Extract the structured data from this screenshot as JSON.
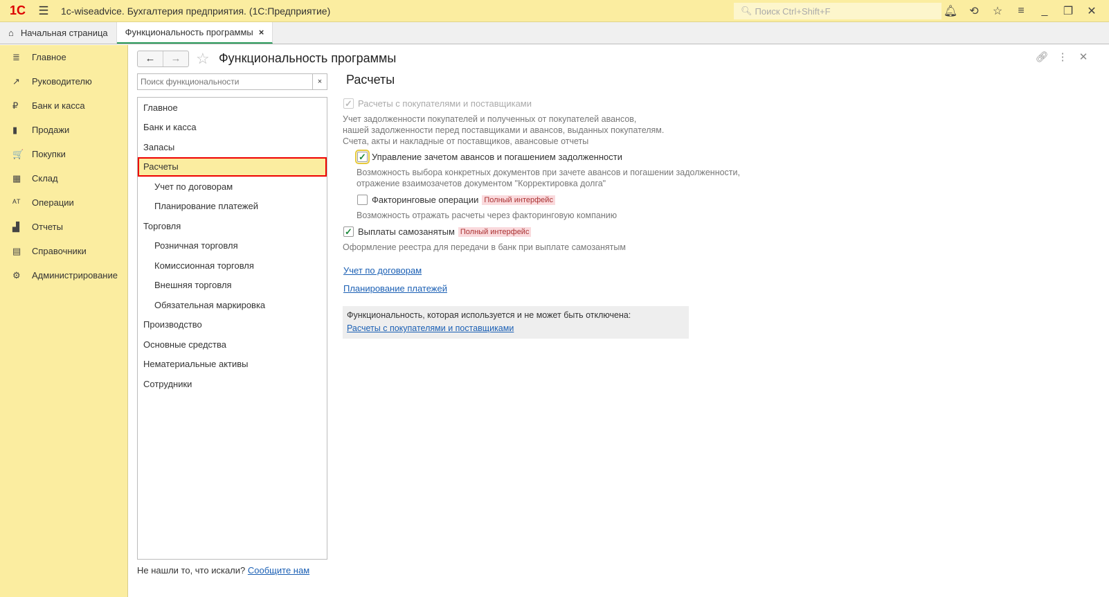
{
  "titlebar": {
    "logo": "1С",
    "title": "1c-wiseadvice. Бухгалтерия предприятия.  (1С:Предприятие)",
    "search_placeholder": "Поиск Ctrl+Shift+F"
  },
  "tabs": [
    {
      "label": "Начальная страница"
    },
    {
      "label": "Функциональность программы",
      "close": "×"
    }
  ],
  "sidebar": [
    {
      "label": "Главное",
      "icon": "≣"
    },
    {
      "label": "Руководителю",
      "icon": "↗"
    },
    {
      "label": "Банк и касса",
      "icon": "₽"
    },
    {
      "label": "Продажи",
      "icon": "▮"
    },
    {
      "label": "Покупки",
      "icon": "🛒"
    },
    {
      "label": "Склад",
      "icon": "▦"
    },
    {
      "label": "Операции",
      "icon": "ᴬᵀ"
    },
    {
      "label": "Отчеты",
      "icon": "▟"
    },
    {
      "label": "Справочники",
      "icon": "▤"
    },
    {
      "label": "Администрирование",
      "icon": "⚙"
    }
  ],
  "page": {
    "title": "Функциональность программы",
    "search_placeholder": "Поиск функциональности",
    "search_clear": "×",
    "list": [
      {
        "label": "Главное",
        "sub": false
      },
      {
        "label": "Банк и касса",
        "sub": false
      },
      {
        "label": "Запасы",
        "sub": false
      },
      {
        "label": "Расчеты",
        "sub": false,
        "selected": true
      },
      {
        "label": "Учет по договорам",
        "sub": true
      },
      {
        "label": "Планирование платежей",
        "sub": true
      },
      {
        "label": "Торговля",
        "sub": false
      },
      {
        "label": "Розничная торговля",
        "sub": true
      },
      {
        "label": "Комиссионная торговля",
        "sub": true
      },
      {
        "label": "Внешняя торговля",
        "sub": true
      },
      {
        "label": "Обязательная маркировка",
        "sub": true
      },
      {
        "label": "Производство",
        "sub": false
      },
      {
        "label": "Основные средства",
        "sub": false
      },
      {
        "label": "Нематериальные активы",
        "sub": false
      },
      {
        "label": "Сотрудники",
        "sub": false
      }
    ],
    "footer_text": "Не нашли то, что искали?",
    "footer_link": "Сообщите нам"
  },
  "content": {
    "section": "Расчеты",
    "opt1": {
      "label": "Расчеты с покупателями и поставщиками",
      "checked": true,
      "disabled": true,
      "desc": [
        "Учет задолженности покупателей и полученных от покупателей авансов,",
        "нашей задолженности перед поставщиками и авансов, выданных покупателям.",
        "Счета, акты и накладные от поставщиков, авансовые отчеты"
      ]
    },
    "opt2": {
      "label": "Управление зачетом авансов и погашением задолженности",
      "checked": true,
      "desc": [
        "Возможность выбора конкретных документов при зачете авансов и погашении задолженности,",
        "отражение взаимозачетов документом \"Корректировка долга\""
      ]
    },
    "opt3": {
      "label": "Факторинговые операции",
      "checked": false,
      "badge": "Полный интерфейс",
      "desc": "Возможность отражать расчеты через факторинговую компанию"
    },
    "opt4": {
      "label": "Выплаты самозанятым",
      "checked": true,
      "badge": "Полный интерфейс",
      "desc": "Оформление реестра для передачи в банк при выплате самозанятым"
    },
    "link1": "Учет по договорам",
    "link2": "Планирование платежей",
    "info_text": "Функциональность, которая используется и не может быть отключена:",
    "info_link": "Расчеты с покупателями и поставщиками"
  }
}
